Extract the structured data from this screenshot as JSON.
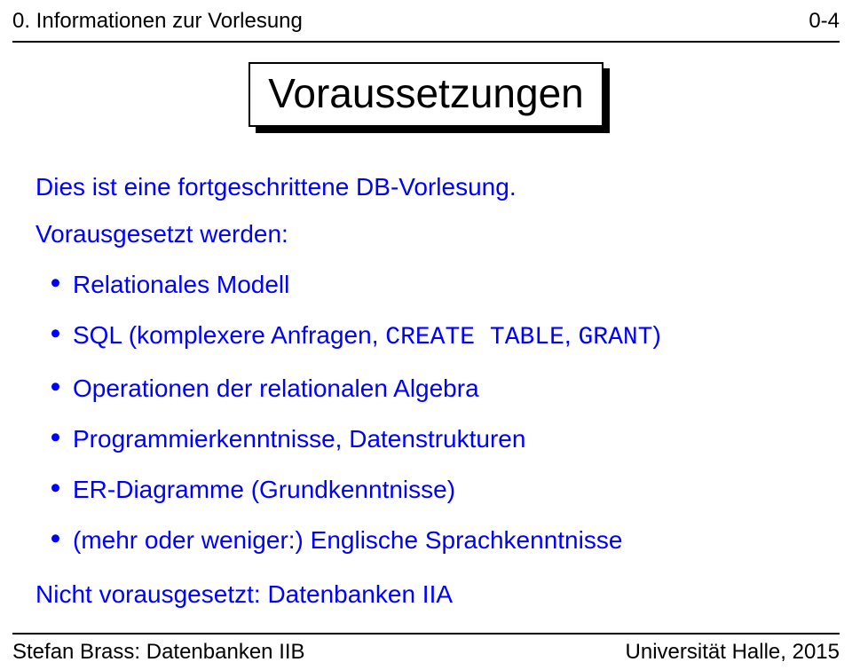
{
  "header": {
    "left": "0. Informationen zur Vorlesung",
    "right": "0-4"
  },
  "title": "Voraussetzungen",
  "body": {
    "intro": "Dies ist eine fortgeschrittene DB-Vorlesung.",
    "lead": "Vorausgesetzt werden:",
    "items": [
      {
        "text": "Relationales Modell"
      },
      {
        "pre": "SQL (komplexere Anfragen, ",
        "code": "CREATE TABLE",
        "mid": ", ",
        "code2": "GRANT",
        "post": ")"
      },
      {
        "text": "Operationen der relationalen Algebra"
      },
      {
        "text": "Programmierkenntnisse, Datenstrukturen"
      },
      {
        "text": "ER-Diagramme (Grundkenntnisse)"
      },
      {
        "text": "(mehr oder weniger:) Englische Sprachkenntnisse"
      }
    ],
    "closing": "Nicht vorausgesetzt: Datenbanken IIA"
  },
  "footer": {
    "left": "Stefan Brass: Datenbanken IIB",
    "right": "Universität Halle, 2015"
  }
}
